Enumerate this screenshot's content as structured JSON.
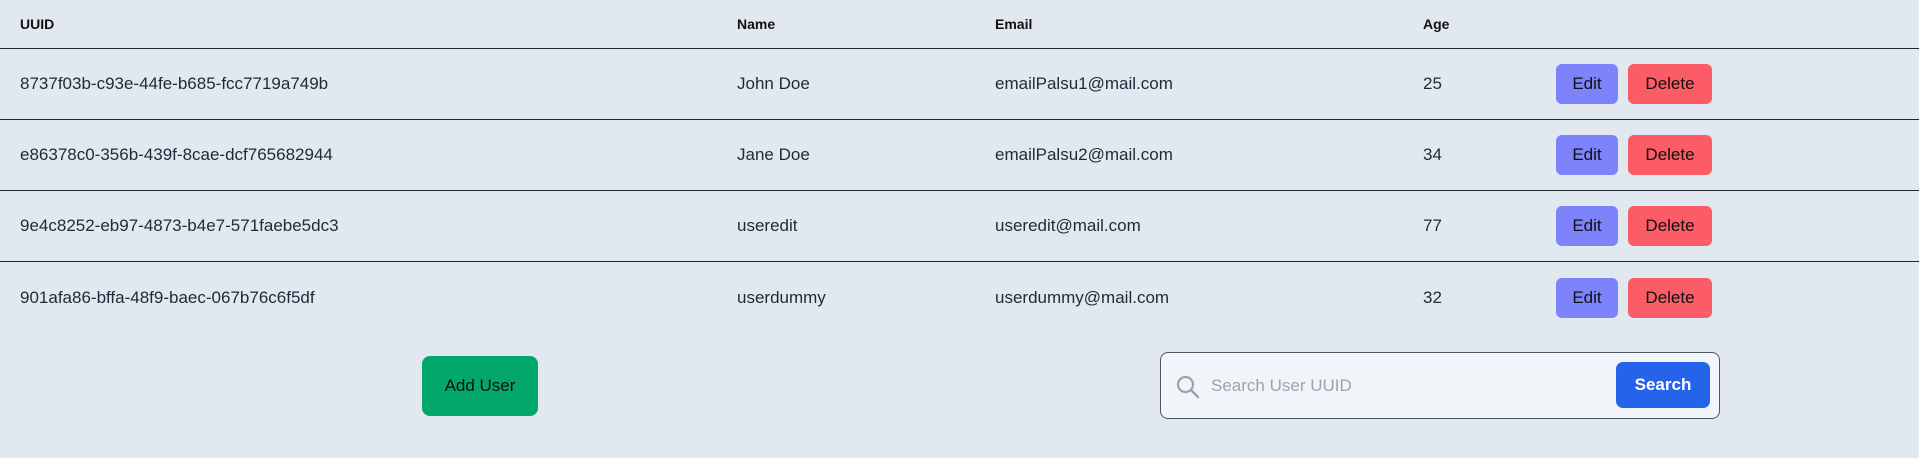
{
  "table": {
    "headers": {
      "uuid": "UUID",
      "name": "Name",
      "email": "Email",
      "age": "Age"
    },
    "rows": [
      {
        "uuid": "8737f03b-c93e-44fe-b685-fcc7719a749b",
        "name": "John Doe",
        "email": "emailPalsu1@mail.com",
        "age": "25"
      },
      {
        "uuid": "e86378c0-356b-439f-8cae-dcf765682944",
        "name": "Jane Doe",
        "email": "emailPalsu2@mail.com",
        "age": "34"
      },
      {
        "uuid": "9e4c8252-eb97-4873-b4e7-571faebe5dc3",
        "name": "useredit",
        "email": "useredit@mail.com",
        "age": "77"
      },
      {
        "uuid": "901afa86-bffa-48f9-baec-067b76c6f5df",
        "name": "userdummy",
        "email": "userdummy@mail.com",
        "age": "32"
      }
    ],
    "edit_label": "Edit",
    "delete_label": "Delete"
  },
  "add_user": {
    "label": "Add User"
  },
  "search": {
    "placeholder": "Search User UUID",
    "value": "",
    "button_label": "Search",
    "icon": "search-icon"
  },
  "colors": {
    "background": "#e2e8f0",
    "edit": "#7c83fb",
    "delete": "#fb5c66",
    "add": "#03a66b",
    "search_button": "#2563eb"
  }
}
